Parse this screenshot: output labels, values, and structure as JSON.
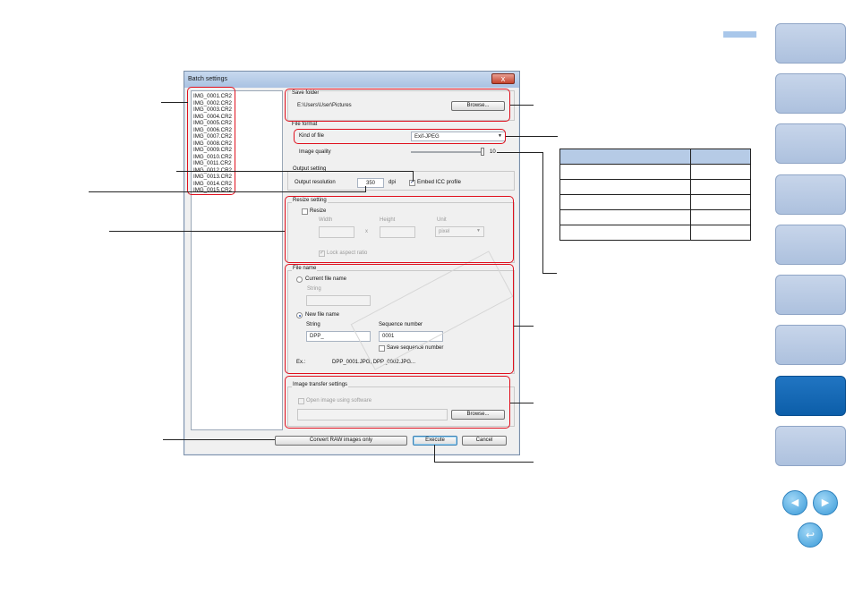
{
  "dialog": {
    "title": "Batch settings",
    "close_glyph": "x",
    "files": [
      "IMG_0001.CR2",
      "IMG_0002.CR2",
      "IMG_0003.CR2",
      "IMG_0004.CR2",
      "IMG_0005.CR2",
      "IMG_0006.CR2",
      "IMG_0007.CR2",
      "IMG_0008.CR2",
      "IMG_0009.CR2",
      "IMG_0010.CR2",
      "IMG_0011.CR2",
      "IMG_0012.CR2",
      "IMG_0013.CR2",
      "IMG_0014.CR2",
      "IMG_0015.CR2"
    ],
    "save_folder": {
      "label": "Save folder",
      "path": "E:\\Users\\User\\Pictures",
      "browse": "Browse..."
    },
    "file_format": {
      "label": "File format",
      "kind_label": "Kind of file",
      "kind_value": "Exif-JPEG",
      "quality_label": "Image quality",
      "quality_value": "10",
      "quality_max": 10
    },
    "output": {
      "label": "Output setting",
      "resolution_label": "Output resolution",
      "resolution_value": "350",
      "unit": "dpi",
      "embed_icc": "Embed ICC profile"
    },
    "resize": {
      "label": "Resize setting",
      "resize": "Resize",
      "width": "Width",
      "height": "Height",
      "unit_label": "Unit",
      "x": "x",
      "unit_value": "pixel",
      "lock": "Lock aspect ratio"
    },
    "file_name": {
      "label": "File name",
      "current": "Current file name",
      "string_label": "String",
      "new": "New file name",
      "string2_label": "String",
      "string_value": "DPP_",
      "seq_label": "Sequence number",
      "seq_value": "0001",
      "save_seq": "Save sequence number",
      "ex_label": "Ex.:",
      "ex_value": "DPP_0001.JPG, DPP_0002.JPG..."
    },
    "transfer": {
      "label": "Image transfer settings",
      "open": "Open image using software",
      "browse": "Browse..."
    },
    "buttons": {
      "convert": "Convert RAW images only",
      "execute": "Execute",
      "cancel": "Cancel"
    }
  },
  "nav": {
    "prev_glyph": "◀",
    "next_glyph": "▶",
    "return_glyph": "↩"
  },
  "colors": {
    "highlight": "#e0101e",
    "tab": "#b8c9e3",
    "tab_active": "#1066b6",
    "table_header": "#b6cbe6"
  }
}
